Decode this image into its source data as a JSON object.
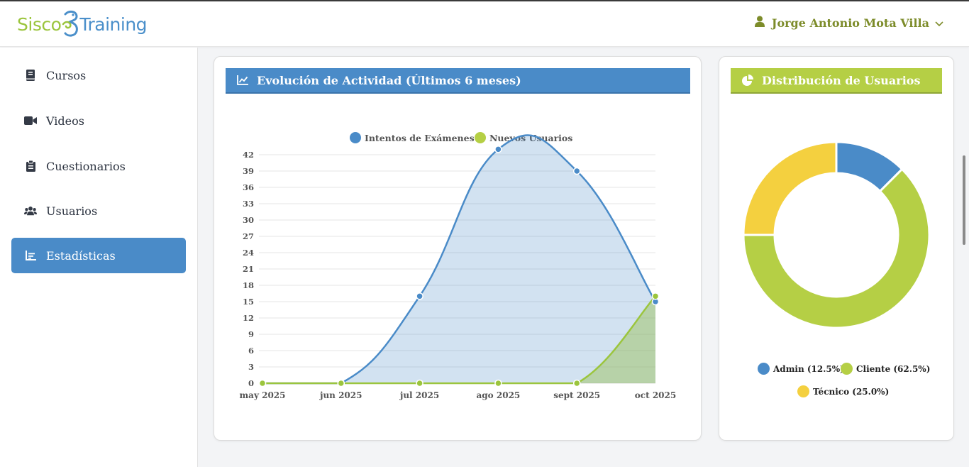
{
  "brand": {
    "part1": "Sisco",
    "part2": "Training"
  },
  "user": {
    "name": "Jorge Antonio Mota Villa"
  },
  "sidebar": {
    "items": [
      {
        "label": "Cursos",
        "icon": "book-icon"
      },
      {
        "label": "Videos",
        "icon": "video-camera-icon"
      },
      {
        "label": "Cuestionarios",
        "icon": "clipboard-icon"
      },
      {
        "label": "Usuarios",
        "icon": "users-icon"
      },
      {
        "label": "Estadísticas",
        "icon": "bar-chart-icon",
        "active": true
      }
    ]
  },
  "activity": {
    "title": "Evolución de Actividad (Últimos 6 meses)",
    "legend": {
      "series1": "Intentos de Exámenes",
      "series2": "Nuevos Usuarios"
    }
  },
  "distribution": {
    "title": "Distribución de Usuarios",
    "legend": {
      "admin": "Admin (12.5%)",
      "cliente": "Cliente (62.5%)",
      "tecnico": "Técnico (25.0%)"
    }
  },
  "chart_data": [
    {
      "type": "area",
      "title": "Evolución de Actividad (Últimos 6 meses)",
      "categories": [
        "may 2025",
        "jun 2025",
        "jul 2025",
        "ago 2025",
        "sept 2025",
        "oct 2025"
      ],
      "yticks": [
        "0",
        "3",
        "6",
        "9",
        "12",
        "15",
        "18",
        "21",
        "24",
        "27",
        "30",
        "33",
        "36",
        "39",
        "42"
      ],
      "ylim": [
        0,
        42
      ],
      "grid": true,
      "legend": "top",
      "series": [
        {
          "name": "Intentos de Exámenes",
          "values": [
            0,
            0,
            16,
            43,
            39,
            15
          ],
          "color": "#4a8bc8"
        },
        {
          "name": "Nuevos Usuarios",
          "values": [
            0,
            0,
            0,
            0,
            0,
            16
          ],
          "color": "#9bc53d"
        }
      ]
    },
    {
      "type": "pie",
      "title": "Distribución de Usuarios",
      "labels": [
        "Admin",
        "Cliente",
        "Técnico"
      ],
      "values": [
        12.5,
        62.5,
        25.0
      ],
      "colors": [
        "#4a8bc8",
        "#b5cf45",
        "#f4d03f"
      ],
      "legend": "bottom"
    }
  ]
}
